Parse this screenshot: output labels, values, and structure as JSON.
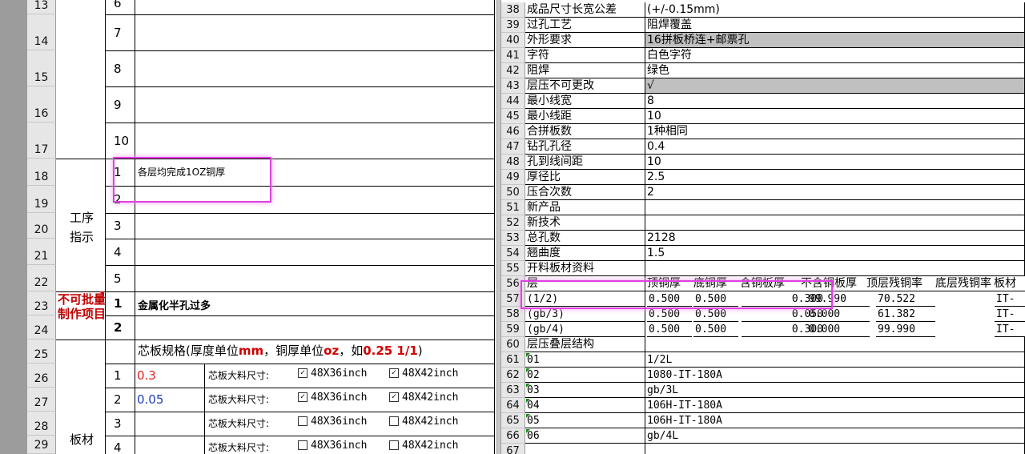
{
  "left": {
    "row_numbers": [
      "13",
      "14",
      "15",
      "16",
      "17",
      "18",
      "19",
      "20",
      "21",
      "22",
      "23",
      "24",
      "25",
      "26",
      "27",
      "28",
      "29"
    ],
    "top_partial_index": "6",
    "indexes": [
      "7",
      "8",
      "9",
      "10"
    ],
    "process_indexes": [
      "1",
      "2",
      "3",
      "4",
      "5"
    ],
    "process_label": "工序指示",
    "process_note_1": "各层均完成1OZ铜厚",
    "no_batch_label": "不可批量制作项目",
    "no_batch_indexes": [
      "1",
      "2"
    ],
    "no_batch_note_1": "金属化半孔过多",
    "spec_title_a": "芯板规格(厚度单位",
    "spec_title_mm": "mm",
    "spec_title_b": "，铜厚单位",
    "spec_title_oz": "oz",
    "spec_title_c": "，如",
    "spec_title_example": "0.25 1/1",
    "spec_title_d": ")",
    "board_label": "板材",
    "board_rows": [
      {
        "idx": "1",
        "thickness": "0.3",
        "thickness_color": "#e02020",
        "size_label": "芯板大料尺寸:",
        "opt1": "48X36inch",
        "opt1_checked": true,
        "opt2": "48X42inch",
        "opt2_checked": true
      },
      {
        "idx": "2",
        "thickness": "0.05",
        "thickness_color": "#1f3fbf",
        "size_label": "芯板大料尺寸:",
        "opt1": "48X36inch",
        "opt1_checked": true,
        "opt2": "48X42inch",
        "opt2_checked": true
      },
      {
        "idx": "3",
        "thickness": "",
        "thickness_color": "#000000",
        "size_label": "芯板大料尺寸:",
        "opt1": "48X36inch",
        "opt1_checked": false,
        "opt2": "48X42inch",
        "opt2_checked": false
      },
      {
        "idx": "4",
        "thickness": "",
        "thickness_color": "#000000",
        "size_label": "芯板大料尺寸:",
        "opt1": "48X36inch",
        "opt1_checked": false,
        "opt2": "48X42inch",
        "opt2_checked": false
      }
    ]
  },
  "right": {
    "rows": [
      {
        "n": "38",
        "label": "成品尺寸长宽公差",
        "value": "(+/-0.15mm)"
      },
      {
        "n": "39",
        "label": "过孔工艺",
        "value": "阻焊覆盖"
      },
      {
        "n": "40",
        "label": "外形要求",
        "value": "16拼板桥连+邮票孔",
        "gray": true
      },
      {
        "n": "41",
        "label": "字符",
        "value": "白色字符"
      },
      {
        "n": "42",
        "label": "阻焊",
        "value": "绿色"
      },
      {
        "n": "43",
        "label": "层压不可更改",
        "value": "√",
        "gray": true
      },
      {
        "n": "44",
        "label": "最小线宽",
        "value": "8"
      },
      {
        "n": "45",
        "label": "最小线距",
        "value": "10"
      },
      {
        "n": "46",
        "label": "合拼板数",
        "value": "1种相同"
      },
      {
        "n": "47",
        "label": "钻孔孔径",
        "value": "0.4"
      },
      {
        "n": "48",
        "label": "孔到线间距",
        "value": "10"
      },
      {
        "n": "49",
        "label": "厚径比",
        "value": "2.5"
      },
      {
        "n": "50",
        "label": "压合次数",
        "value": "2"
      },
      {
        "n": "51",
        "label": "新产品",
        "value": ""
      },
      {
        "n": "52",
        "label": "新技术",
        "value": ""
      },
      {
        "n": "53",
        "label": "总孔数",
        "value": "2128"
      },
      {
        "n": "54",
        "label": "翘曲度",
        "value": "1.5"
      },
      {
        "n": "55",
        "label": "开料板材资料",
        "value": ""
      }
    ],
    "layer_header": {
      "n": "56",
      "label": "层",
      "cols": [
        "顶铜厚",
        "底铜厚",
        "含铜板厚",
        "不含铜板厚",
        "顶层残铜率",
        "底层残铜率",
        "板材"
      ]
    },
    "layer_rows": [
      {
        "n": "57",
        "label": "(1/2)",
        "v": [
          "0.500",
          "0.500",
          "",
          "0.300",
          "99.990",
          "70.522",
          "IT-"
        ]
      },
      {
        "n": "58",
        "label": "(gb/3)",
        "v": [
          "0.500",
          "0.500",
          "",
          "0.050",
          "0.000",
          "61.382",
          "IT-"
        ]
      },
      {
        "n": "59",
        "label": "(gb/4)",
        "v": [
          "0.500",
          "0.500",
          "",
          "0.300",
          "0.000",
          "99.990",
          "IT-"
        ]
      }
    ],
    "stack_title": {
      "n": "60",
      "label": "层压叠层结构"
    },
    "stack_rows": [
      {
        "n": "61",
        "label": "01",
        "value": "1/2L"
      },
      {
        "n": "62",
        "label": "02",
        "value": "1080-IT-180A"
      },
      {
        "n": "63",
        "label": "03",
        "value": "gb/3L"
      },
      {
        "n": "64",
        "label": "04",
        "value": "106H-IT-180A"
      },
      {
        "n": "65",
        "label": "05",
        "value": "106H-IT-180A"
      },
      {
        "n": "66",
        "label": "06",
        "value": "gb/4L"
      },
      {
        "n": "67",
        "label": "",
        "value": ""
      }
    ]
  }
}
